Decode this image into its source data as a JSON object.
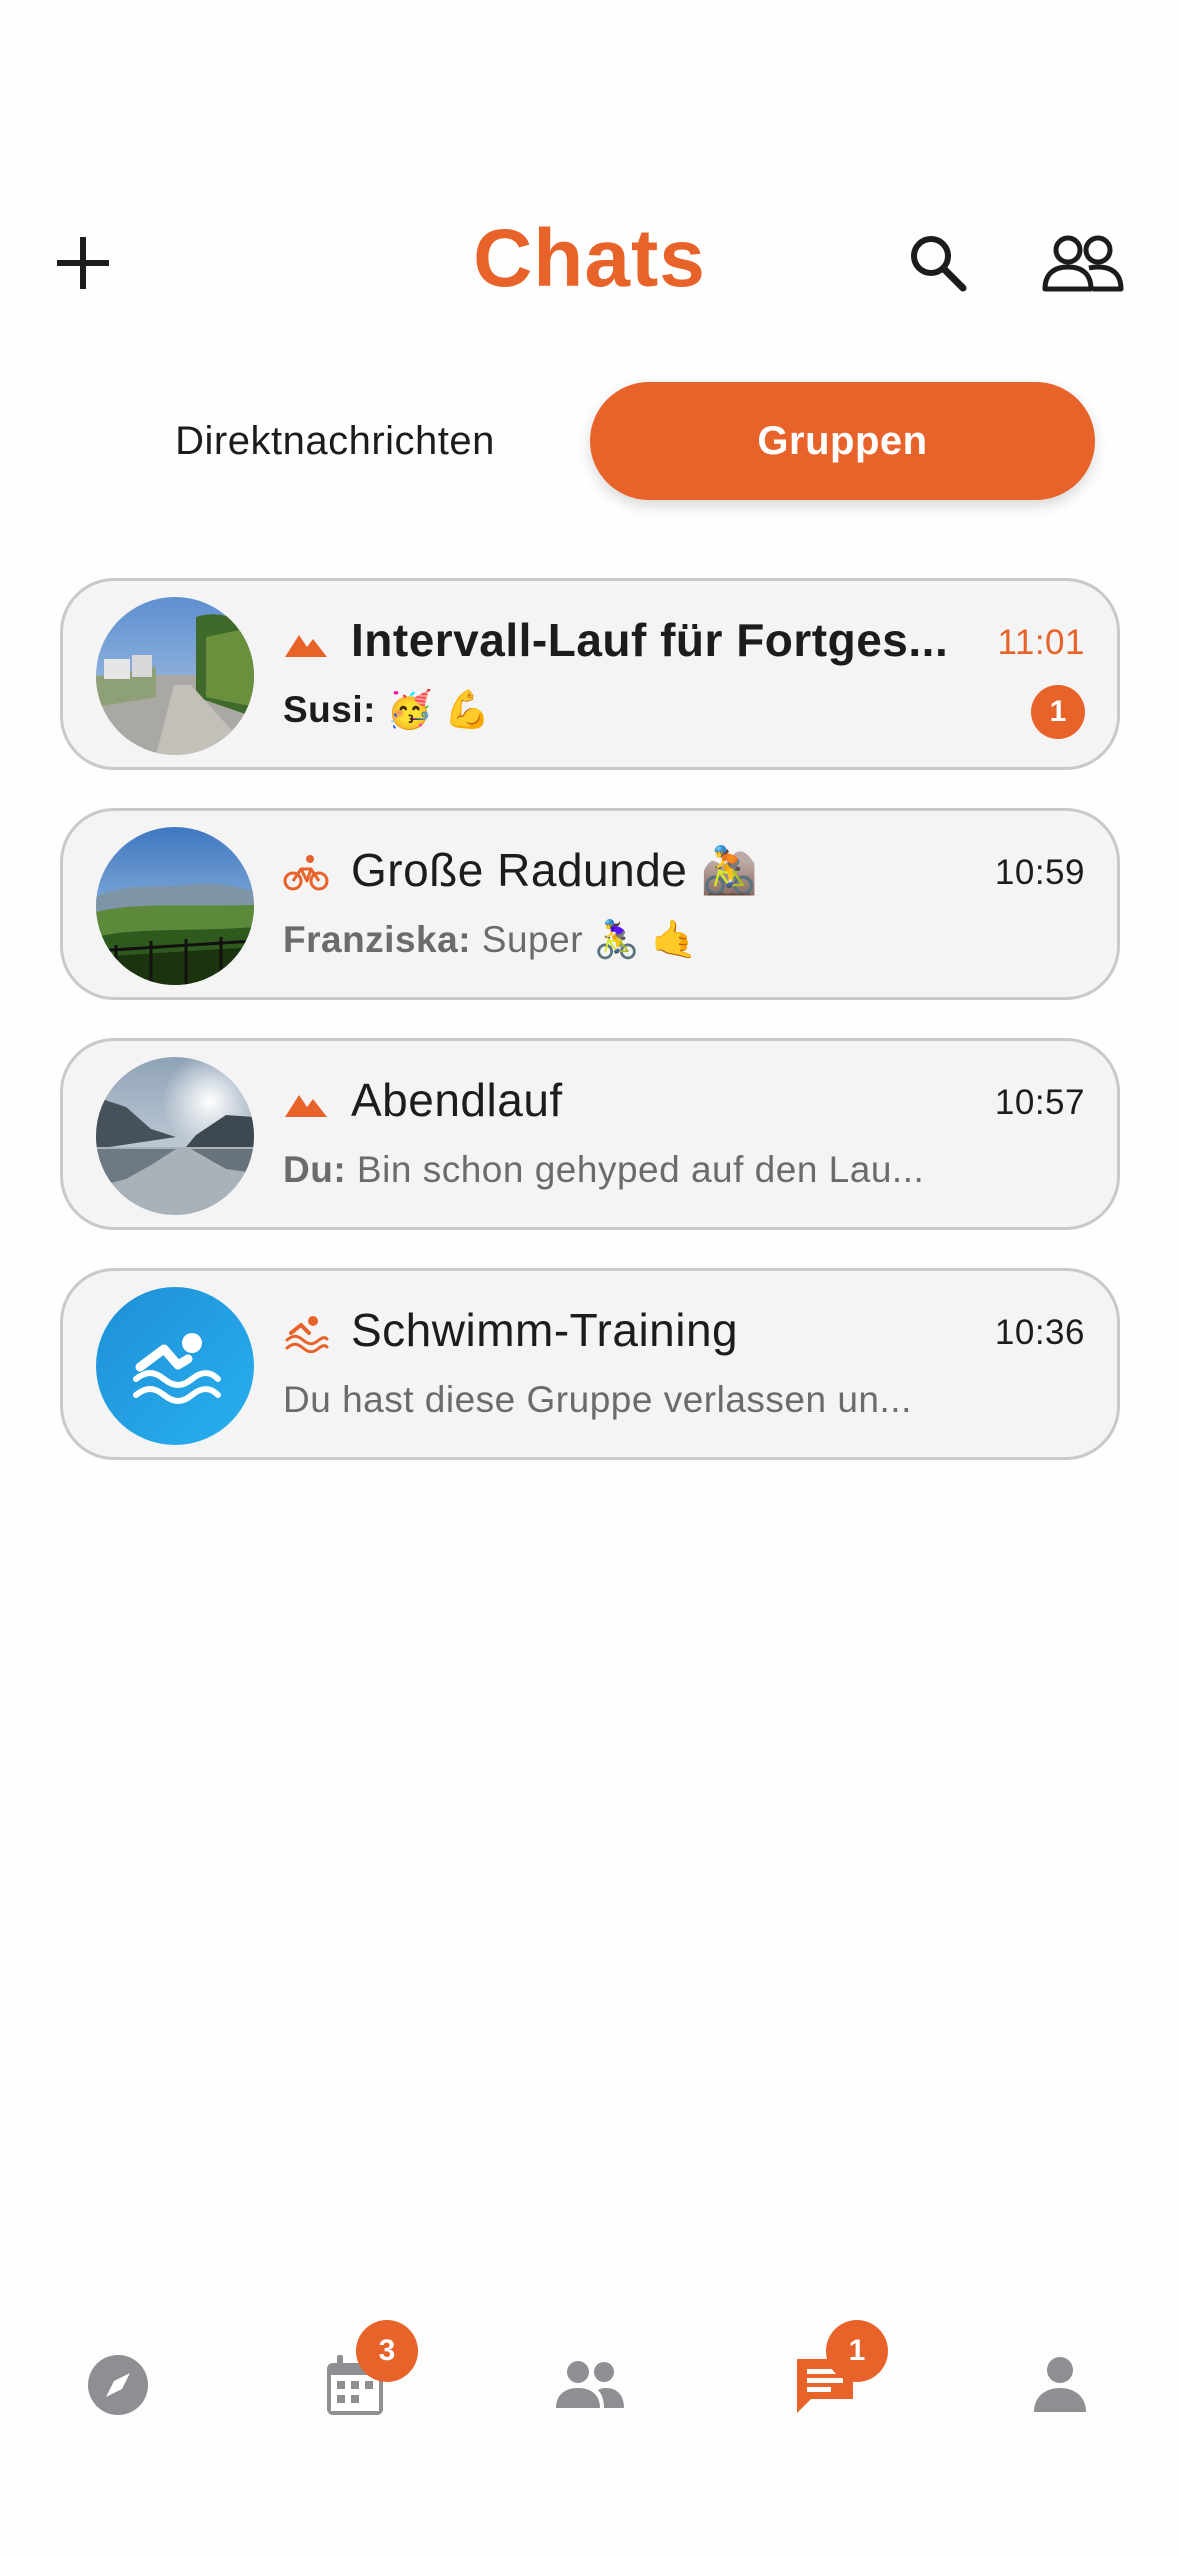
{
  "header": {
    "title": "Chats",
    "add_icon": "plus-icon",
    "search_icon": "search-icon",
    "contacts_icon": "people-icon"
  },
  "tabs": [
    {
      "label": "Direktnachrichten",
      "selected": false
    },
    {
      "label": "Gruppen",
      "selected": true
    }
  ],
  "chats": [
    {
      "sport_icon": "mountain-icon",
      "title": "Intervall-Lauf für Fortges...",
      "time": "11:01",
      "sender": "Susi:",
      "message": " 🥳 💪",
      "unread_count": "1",
      "unread": true,
      "avatar": "park-path-photo"
    },
    {
      "sport_icon": "bicycle-icon",
      "title": "Große Radunde 🚵",
      "time": "10:59",
      "sender": "Franziska:",
      "message": " Super 🚴‍♀️ 🤙",
      "unread": false,
      "avatar": "hills-landscape-photo"
    },
    {
      "sport_icon": "mountain-icon",
      "title": "Abendlauf",
      "time": "10:57",
      "sender": "Du:",
      "message": " Bin schon gehyped auf den Lau...",
      "unread": false,
      "avatar": "lake-mountains-photo"
    },
    {
      "sport_icon": "swimming-icon",
      "title": "Schwimm-Training",
      "time": "10:36",
      "sender": "",
      "message": "Du hast diese Gruppe verlassen un...",
      "unread": false,
      "avatar": "swimmer-avatar"
    }
  ],
  "bottom_nav": [
    {
      "icon": "compass-icon",
      "badge": null,
      "active": false
    },
    {
      "icon": "calendar-icon",
      "badge": "3",
      "active": false
    },
    {
      "icon": "group-icon",
      "badge": null,
      "active": false
    },
    {
      "icon": "chat-icon",
      "badge": "1",
      "active": true
    },
    {
      "icon": "profile-icon",
      "badge": null,
      "active": false
    }
  ],
  "colors": {
    "accent": "#e8632a",
    "card_bg": "#f4f4f4",
    "card_border": "#c9c9c9",
    "nav_inactive": "#8e8e93",
    "swim_avatar": "#1e9be0"
  }
}
